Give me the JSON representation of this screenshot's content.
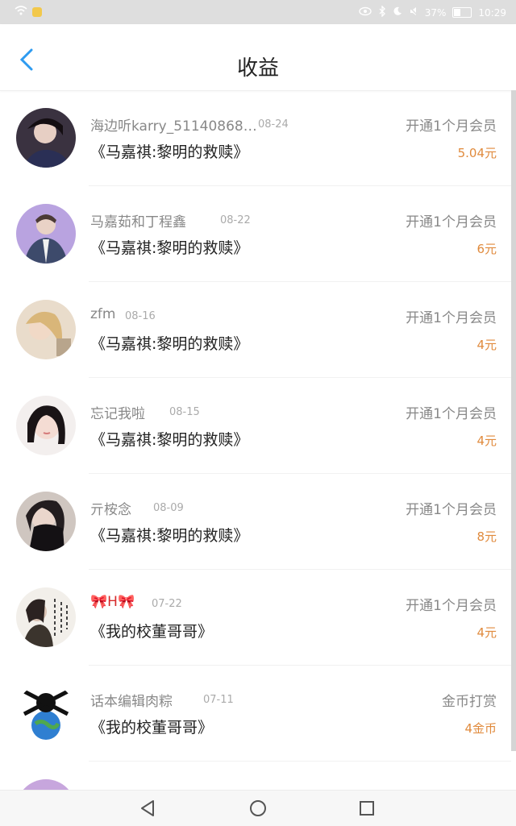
{
  "status_bar": {
    "battery": "37%",
    "time": "10:29"
  },
  "header": {
    "title": "收益"
  },
  "items": [
    {
      "name": "海边听karry_51140868…",
      "date": "08-24",
      "desc": "《马嘉祺:黎明的救赎》",
      "type": "开通1个月会员",
      "amount": "5.04元"
    },
    {
      "name": "马嘉茹和丁程鑫",
      "date": "08-22",
      "desc": "《马嘉祺:黎明的救赎》",
      "type": "开通1个月会员",
      "amount": "6元"
    },
    {
      "name": "zfm",
      "date": "08-16",
      "desc": "《马嘉祺:黎明的救赎》",
      "type": "开通1个月会员",
      "amount": "4元"
    },
    {
      "name": "忘记我啦",
      "date": "08-15",
      "desc": "《马嘉祺:黎明的救赎》",
      "type": "开通1个月会员",
      "amount": "4元"
    },
    {
      "name": "亓桉念",
      "date": "08-09",
      "desc": "《马嘉祺:黎明的救赎》",
      "type": "开通1个月会员",
      "amount": "8元"
    },
    {
      "name": "🎀H🎀",
      "date": "07-22",
      "desc": "《我的校董哥哥》",
      "type": "开通1个月会员",
      "amount": "4元"
    },
    {
      "name": "话本编辑肉粽",
      "date": "07-11",
      "desc": "《我的校董哥哥》",
      "type": "金币打赏",
      "amount": "4金币"
    }
  ],
  "colors": {
    "accent": "#2e9bf0",
    "amount": "#e08a3c"
  }
}
